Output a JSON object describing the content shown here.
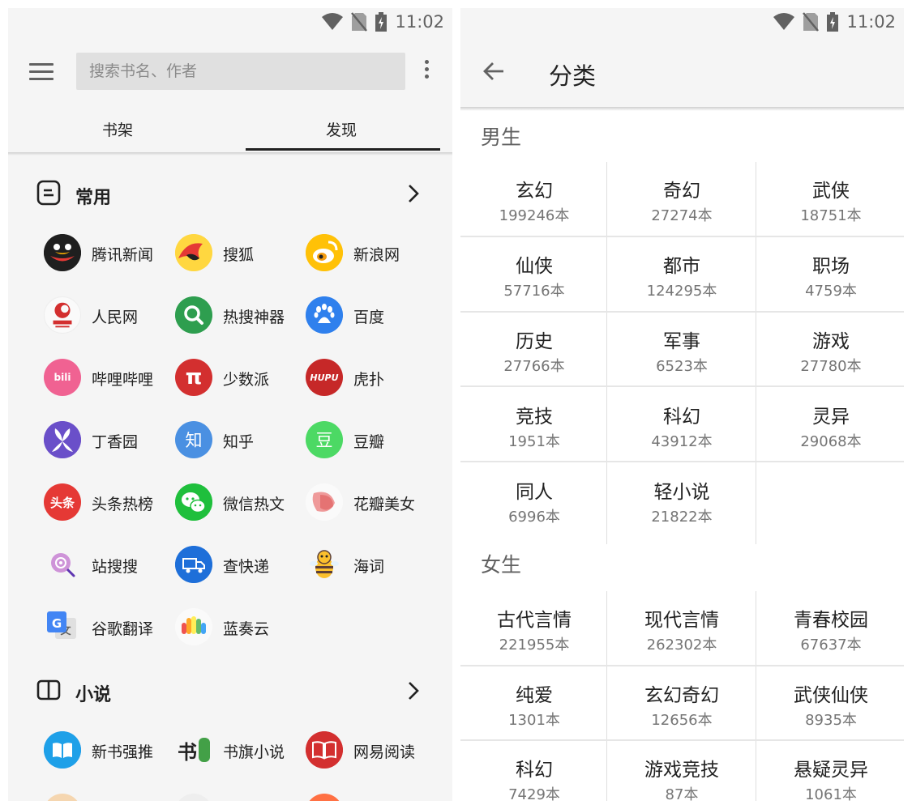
{
  "status": {
    "time": "11:02"
  },
  "left": {
    "search": {
      "placeholder": "搜索书名、作者"
    },
    "tabs": [
      {
        "label": "书架"
      },
      {
        "label": "发现"
      }
    ],
    "sections": [
      {
        "title": "常用",
        "items": [
          {
            "label": "腾讯新闻"
          },
          {
            "label": "搜狐"
          },
          {
            "label": "新浪网"
          },
          {
            "label": "人民网"
          },
          {
            "label": "热搜神器"
          },
          {
            "label": "百度"
          },
          {
            "label": "哔哩哔哩"
          },
          {
            "label": "少数派"
          },
          {
            "label": "虎扑"
          },
          {
            "label": "丁香园"
          },
          {
            "label": "知乎"
          },
          {
            "label": "豆瓣"
          },
          {
            "label": "头条热榜"
          },
          {
            "label": "微信热文"
          },
          {
            "label": "花瓣美女"
          },
          {
            "label": "站搜搜"
          },
          {
            "label": "查快递"
          },
          {
            "label": "海词"
          },
          {
            "label": "谷歌翻译"
          },
          {
            "label": "蓝奏云"
          }
        ]
      },
      {
        "title": "小说",
        "items": [
          {
            "label": "新书强推"
          },
          {
            "label": "书旗小说"
          },
          {
            "label": "网易阅读"
          }
        ]
      }
    ],
    "logo_text": {
      "hupu": "HUPU",
      "zhihu": "知",
      "douban": "豆",
      "toutiao": "头条",
      "shaoshupai": "π",
      "bilibili": "bili",
      "shuqi": "书"
    }
  },
  "right": {
    "title": "分类",
    "groups": [
      {
        "label": "男生",
        "categories": [
          {
            "name": "玄幻",
            "count": "199246本"
          },
          {
            "name": "奇幻",
            "count": "27274本"
          },
          {
            "name": "武侠",
            "count": "18751本"
          },
          {
            "name": "仙侠",
            "count": "57716本"
          },
          {
            "name": "都市",
            "count": "124295本"
          },
          {
            "name": "职场",
            "count": "4759本"
          },
          {
            "name": "历史",
            "count": "27766本"
          },
          {
            "name": "军事",
            "count": "6523本"
          },
          {
            "name": "游戏",
            "count": "27780本"
          },
          {
            "name": "竞技",
            "count": "1951本"
          },
          {
            "name": "科幻",
            "count": "43912本"
          },
          {
            "name": "灵异",
            "count": "29068本"
          },
          {
            "name": "同人",
            "count": "6996本"
          },
          {
            "name": "轻小说",
            "count": "21822本"
          }
        ]
      },
      {
        "label": "女生",
        "categories": [
          {
            "name": "古代言情",
            "count": "221955本"
          },
          {
            "name": "现代言情",
            "count": "262302本"
          },
          {
            "name": "青春校园",
            "count": "67637本"
          },
          {
            "name": "纯爱",
            "count": "1301本"
          },
          {
            "name": "玄幻奇幻",
            "count": "12656本"
          },
          {
            "name": "武侠仙侠",
            "count": "8935本"
          },
          {
            "name": "科幻",
            "count": "7429本"
          },
          {
            "name": "游戏竞技",
            "count": "87本"
          },
          {
            "name": "悬疑灵异",
            "count": "1061本"
          }
        ]
      }
    ]
  }
}
